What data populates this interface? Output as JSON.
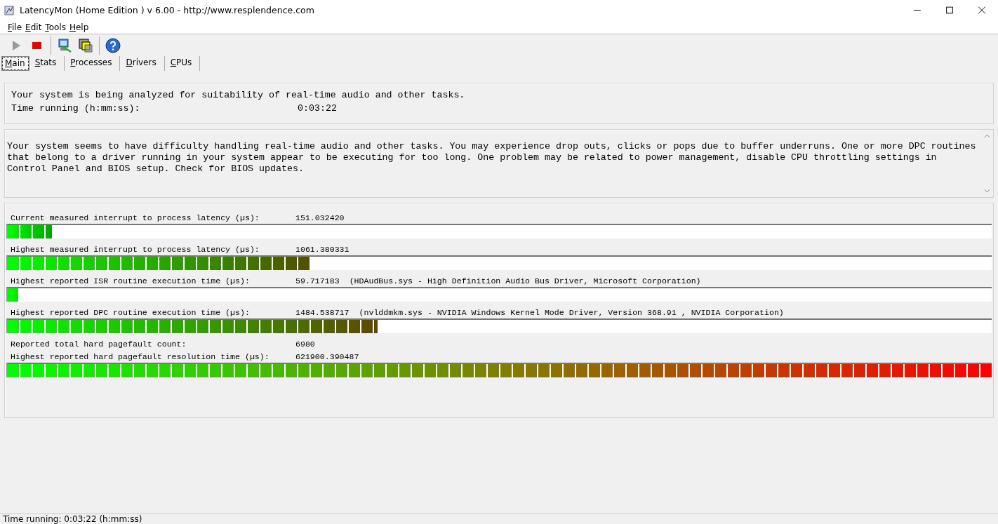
{
  "window": {
    "title": "LatencyMon  (Home Edition )  v 6.00 - http://www.resplendence.com"
  },
  "menu": [
    {
      "label": "File"
    },
    {
      "label": "Edit"
    },
    {
      "label": "Tools"
    },
    {
      "label": "Help"
    }
  ],
  "toolbar": [
    {
      "kind": "play",
      "disabled": true
    },
    {
      "kind": "stop",
      "disabled": false
    },
    {
      "kind": "separator"
    },
    {
      "kind": "computer"
    },
    {
      "kind": "windows"
    },
    {
      "kind": "separator"
    },
    {
      "kind": "help"
    }
  ],
  "tabs": [
    {
      "label": "Main",
      "selected": true
    },
    {
      "label": "Stats",
      "selected": false
    },
    {
      "label": "Processes",
      "selected": false
    },
    {
      "label": "Drivers",
      "selected": false
    },
    {
      "label": "CPUs",
      "selected": false
    }
  ],
  "status_panel": {
    "message": "Your system is being analyzed for suitability of real-time audio and other tasks.",
    "label": "Time running (h:mm:ss):",
    "value": "0:03:22"
  },
  "conclusion": "Your system seems to have difficulty handling real-time audio and other tasks. You may experience drop outs, clicks or pops due to buffer underruns. One or more DPC routines that belong to a driver running in your system appear to be executing for too long. One problem may be related to power management, disable CPU throttling settings in Control Panel and BIOS setup. Check for BIOS updates.",
  "measurements": [
    {
      "label": "Current measured interrupt to process latency (µs):",
      "value": "151.032420",
      "level": 0.045
    },
    {
      "label": "Highest measured interrupt to process latency (µs):",
      "value": "1061.380331",
      "level": 0.308
    },
    {
      "label": "Highest reported ISR routine execution time (µs):",
      "value": "59.717183",
      "detail": "(HDAudBus.sys - High Definition Audio Bus Driver, Microsoft Corporation)",
      "level": 0.011
    },
    {
      "label": "Highest reported DPC routine execution time (µs):",
      "value": "1484.538717",
      "detail": "(nvlddmkm.sys - NVIDIA Windows Kernel Mode Driver, Version 368.91 , NVIDIA Corporation)",
      "level": 0.376
    },
    {
      "label": "Reported total hard pagefault count:",
      "value": "6980"
    },
    {
      "label": "Highest reported hard pagefault resolution time (µs):",
      "value": "621900.390487",
      "level": 1.0
    }
  ],
  "status_bar": "Time running: 0:03:22  (h:mm:ss)"
}
